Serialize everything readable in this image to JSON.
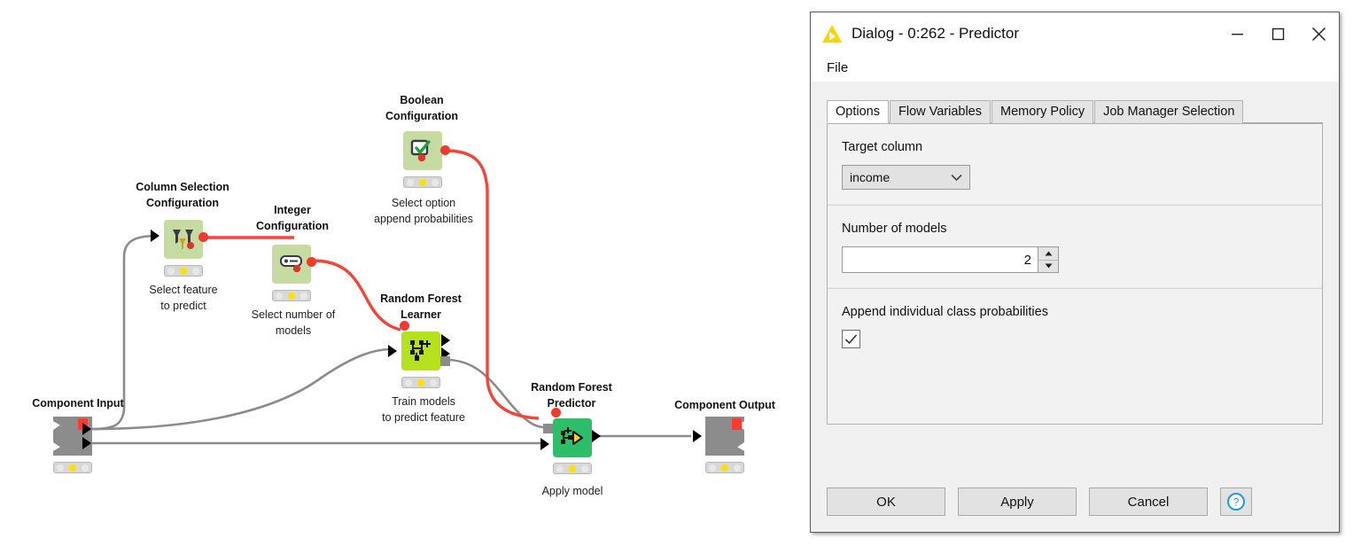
{
  "workflow": {
    "nodes": [
      {
        "id": "component-input",
        "title": "Component Input",
        "desc": ""
      },
      {
        "id": "column-selection-configuration",
        "title": "Column Selection\nConfiguration",
        "desc": "Select feature\nto predict"
      },
      {
        "id": "integer-configuration",
        "title": "Integer\nConfiguration",
        "desc": "Select number of\nmodels"
      },
      {
        "id": "boolean-configuration",
        "title": "Boolean\nConfiguration",
        "desc": "Select option\nappend probabilities"
      },
      {
        "id": "random-forest-learner",
        "title": "Random Forest\nLearner",
        "desc": "Train models\nto predict feature"
      },
      {
        "id": "random-forest-predictor",
        "title": "Random Forest\nPredictor",
        "desc": "Apply model"
      },
      {
        "id": "component-output",
        "title": "Component Output",
        "desc": ""
      }
    ],
    "colors": {
      "flow_variable_connection": "#f5453a",
      "data_connection": "#8c8c8c",
      "configuration_node": "#c6dba2",
      "learner_node": "#b5e11e",
      "predictor_node": "#2ebd6b",
      "io_node": "#8c8c8c"
    }
  },
  "dialog": {
    "title": "Dialog - 0:262 - Predictor",
    "app_icon": "knime-triangle-icon",
    "menu": {
      "file": "File"
    },
    "window_controls": {
      "minimize": "minimize-icon",
      "maximize": "maximize-icon",
      "close": "close-icon"
    },
    "tabs": [
      {
        "label": "Options",
        "active": true
      },
      {
        "label": "Flow Variables",
        "active": false
      },
      {
        "label": "Memory Policy",
        "active": false
      },
      {
        "label": "Job Manager Selection",
        "active": false
      }
    ],
    "options": {
      "target_column": {
        "label": "Target column",
        "value": "income",
        "options": [
          "income"
        ]
      },
      "number_of_models": {
        "label": "Number of models",
        "value": "2"
      },
      "append_probabilities": {
        "label": "Append individual class probabilities",
        "checked": true
      }
    },
    "buttons": {
      "ok": "OK",
      "apply": "Apply",
      "cancel": "Cancel",
      "help": "help-icon"
    }
  }
}
